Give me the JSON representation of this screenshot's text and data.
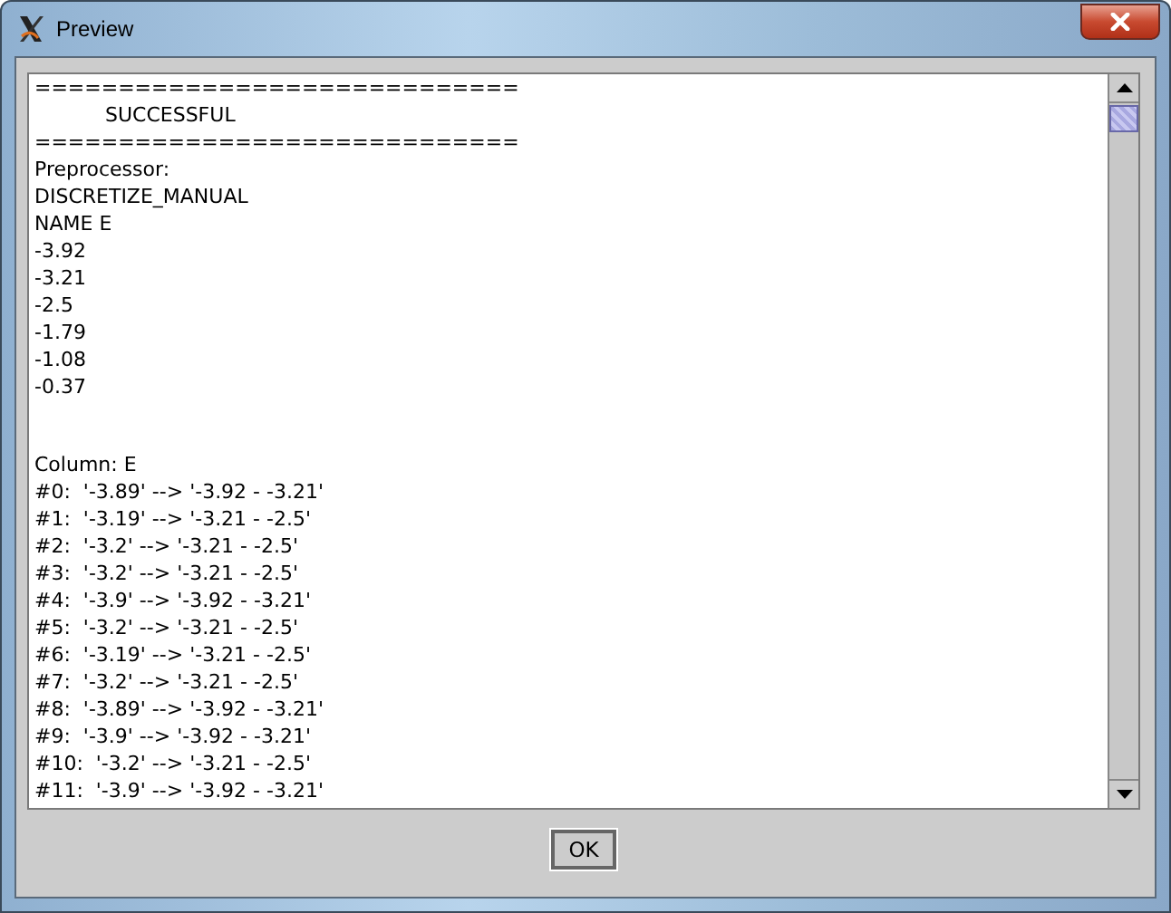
{
  "window": {
    "title": "Preview"
  },
  "output_blocks": [
    [
      {
        "kind": "plain",
        "text": "============================="
      },
      {
        "kind": "indented",
        "text": "SUCCESSFUL"
      },
      {
        "kind": "plain",
        "text": "============================="
      },
      {
        "kind": "plain",
        "text": "Preprocessor:"
      },
      {
        "kind": "plain",
        "text": "DISCRETIZE_MANUAL"
      },
      {
        "kind": "plain",
        "text": "NAME E"
      },
      {
        "kind": "plain",
        "text": "-3.92"
      },
      {
        "kind": "plain",
        "text": "-3.21"
      },
      {
        "kind": "plain",
        "text": "-2.5"
      },
      {
        "kind": "plain",
        "text": "-1.79"
      },
      {
        "kind": "plain",
        "text": "-1.08"
      },
      {
        "kind": "plain",
        "text": "-0.37"
      }
    ],
    [
      {
        "kind": "plain",
        "text": "Column: E"
      },
      {
        "kind": "plain",
        "text": "#0:  '-3.89' --> '-3.92 - -3.21'"
      },
      {
        "kind": "plain",
        "text": "#1:  '-3.19' --> '-3.21 - -2.5'"
      },
      {
        "kind": "plain",
        "text": "#2:  '-3.2' --> '-3.21 - -2.5'"
      },
      {
        "kind": "plain",
        "text": "#3:  '-3.2' --> '-3.21 - -2.5'"
      },
      {
        "kind": "plain",
        "text": "#4:  '-3.9' --> '-3.92 - -3.21'"
      },
      {
        "kind": "plain",
        "text": "#5:  '-3.2' --> '-3.21 - -2.5'"
      },
      {
        "kind": "plain",
        "text": "#6:  '-3.19' --> '-3.21 - -2.5'"
      },
      {
        "kind": "plain",
        "text": "#7:  '-3.2' --> '-3.21 - -2.5'"
      },
      {
        "kind": "plain",
        "text": "#8:  '-3.89' --> '-3.92 - -3.21'"
      },
      {
        "kind": "plain",
        "text": "#9:  '-3.9' --> '-3.92 - -3.21'"
      },
      {
        "kind": "plain",
        "text": "#10:  '-3.2' --> '-3.21 - -2.5'"
      },
      {
        "kind": "plain",
        "text": "#11:  '-3.9' --> '-3.92 - -3.21'"
      }
    ]
  ],
  "buttons": [
    "OK"
  ]
}
